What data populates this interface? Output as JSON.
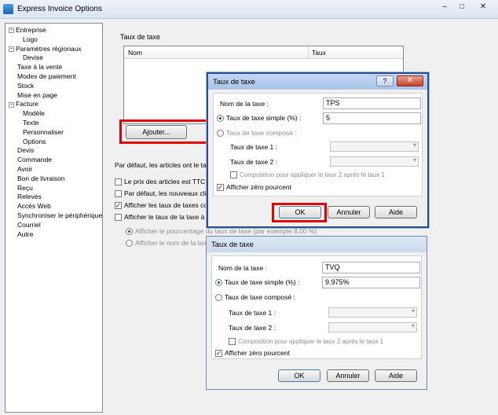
{
  "window": {
    "title": "Express Invoice Options",
    "minimize": "–",
    "maximize": "□",
    "close": "✕"
  },
  "tree": {
    "items": [
      {
        "label": "Entreprise",
        "level": 0,
        "expander": "−"
      },
      {
        "label": "Logo",
        "level": 1
      },
      {
        "label": "Paramètres régionaux",
        "level": 0,
        "expander": "−"
      },
      {
        "label": "Devise",
        "level": 1
      },
      {
        "label": "Taxe à la vente",
        "level": 0
      },
      {
        "label": "Modes de paiement",
        "level": 0
      },
      {
        "label": "Stock",
        "level": 0
      },
      {
        "label": "Mise en page",
        "level": 0
      },
      {
        "label": "Facture",
        "level": 0,
        "expander": "−"
      },
      {
        "label": "Modèle",
        "level": 1
      },
      {
        "label": "Texte",
        "level": 1
      },
      {
        "label": "Personnaliser",
        "level": 1
      },
      {
        "label": "Options",
        "level": 1
      },
      {
        "label": "Devis",
        "level": 0
      },
      {
        "label": "Commande",
        "level": 0
      },
      {
        "label": "Avoir",
        "level": 0
      },
      {
        "label": "Bon de livraison",
        "level": 0
      },
      {
        "label": "Reçu",
        "level": 0
      },
      {
        "label": "Relevés",
        "level": 0
      },
      {
        "label": "Accès Web",
        "level": 0
      },
      {
        "label": "Synchroniser le périphérique",
        "level": 0
      },
      {
        "label": "Courriel",
        "level": 0
      },
      {
        "label": "Autre",
        "level": 0
      }
    ]
  },
  "tax_group": {
    "label": "Taux de taxe",
    "columns": [
      "Nom",
      "Taux"
    ],
    "add_button": "Ajouter..."
  },
  "options": {
    "intro": "Par défaut, les articles ont le tau",
    "items": [
      {
        "label": "Le prix des articles est TTC (t",
        "checked": false
      },
      {
        "label": "Par défaut, les nouveaux clie",
        "checked": false
      },
      {
        "label": "Afficher les taux de taxes cor",
        "checked": true
      },
      {
        "label": "Afficher le taux de la taxe à la",
        "checked": false
      }
    ],
    "radios": [
      {
        "label": "Afficher le pourcentage du taux de taxe (par exemple 8,00 %)",
        "selected": true
      },
      {
        "label": "Afficher le nom de la taxe",
        "selected": false
      }
    ]
  },
  "dialog1": {
    "title": "Taux de taxe",
    "help": "?",
    "close": "✕",
    "name_label": "Nom de la taxe :",
    "name_value": "TPS",
    "simple_label": "Taux de taxe simple (%) :",
    "simple_value": "5",
    "compound_label": "Taux de taxe composé :",
    "rate1_label": "Taux de taxe 1 :",
    "rate2_label": "Taux de taxe 2 :",
    "composition_label": "Composition pour appliquer le taux 2 après le taux 1",
    "zero_label": "Afficher zéro pourcent",
    "ok": "OK",
    "cancel": "Annuler",
    "help_btn": "Aide"
  },
  "dialog2": {
    "title": "Taux de taxe",
    "name_label": "Nom de la taxe :",
    "name_value": "TVQ",
    "simple_label": "Taux de taxe simple (%) :",
    "simple_value": "9.975%",
    "compound_label": "Taux de taxe composé :",
    "rate1_label": "Taux de taxe 1 :",
    "rate2_label": "Taux de taxe 2 :",
    "composition_label": "Composition pour appliquer le taux 2 après le taux 1",
    "zero_label": "Afficher zéro pourcent",
    "ok": "OK",
    "cancel": "Annuler",
    "help_btn": "Aide"
  },
  "colors": {
    "highlight": "#e00000",
    "dialog_border": "#2a4e8a"
  }
}
